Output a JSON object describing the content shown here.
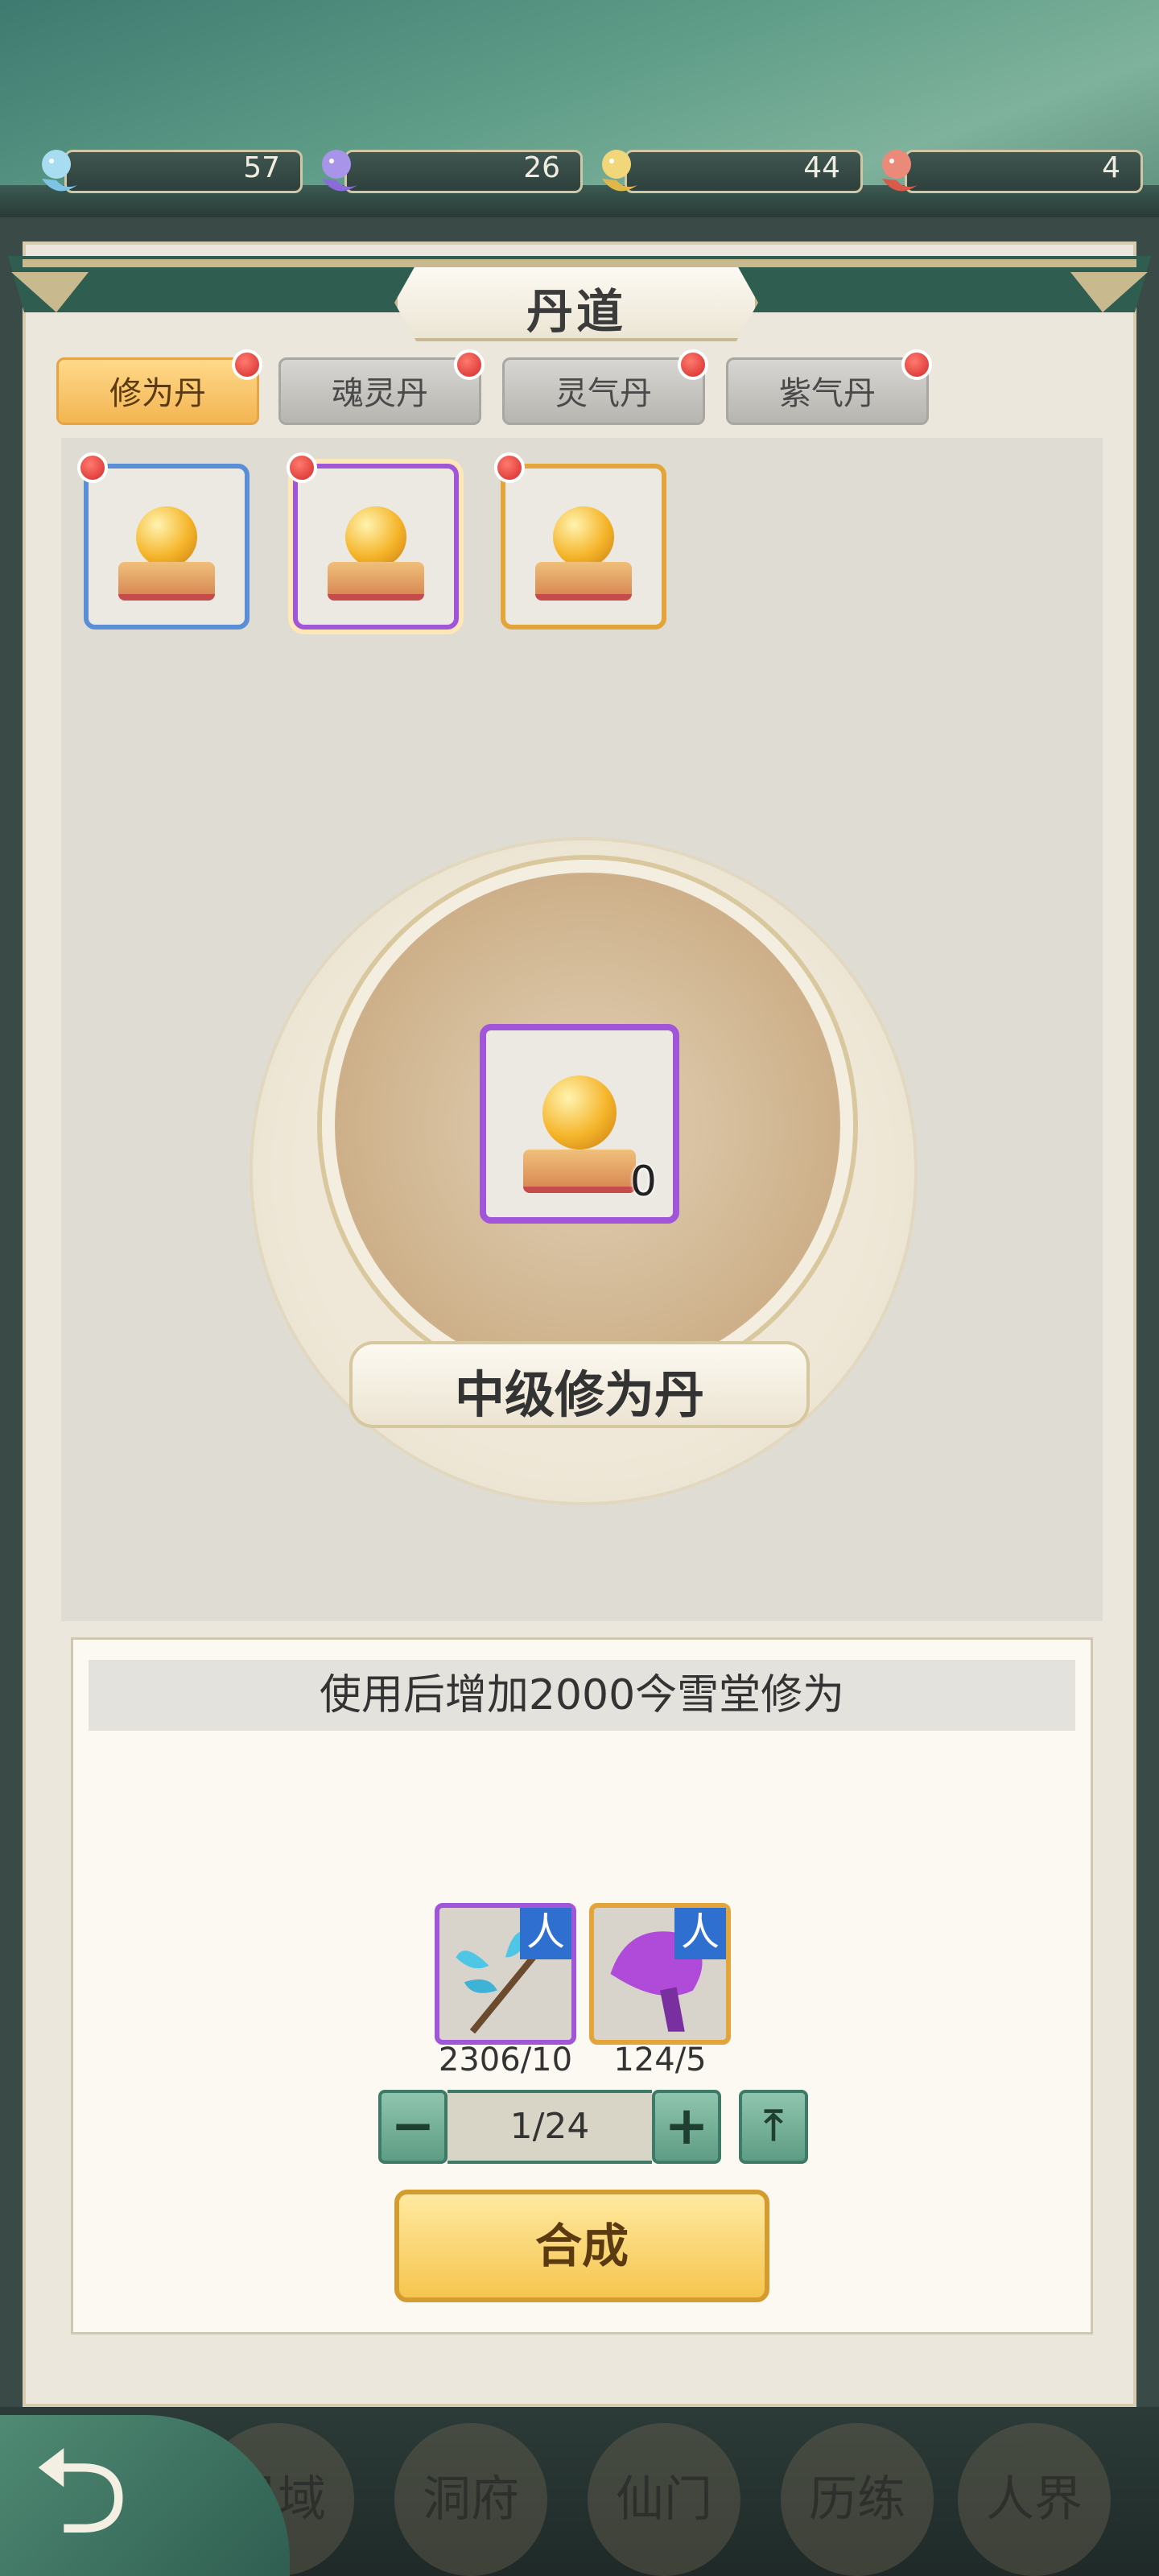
{
  "resources": [
    {
      "name": "blue-spirit",
      "value": "57",
      "color": "#7ec4e6"
    },
    {
      "name": "purple-spirit",
      "value": "26",
      "color": "#8a6cd8"
    },
    {
      "name": "gold-spirit",
      "value": "44",
      "color": "#e0b84a"
    },
    {
      "name": "red-spirit",
      "value": "4",
      "color": "#d85a4a"
    }
  ],
  "header": {
    "title": "丹道"
  },
  "tabs": [
    {
      "label": "修为丹",
      "active": true
    },
    {
      "label": "魂灵丹",
      "active": false
    },
    {
      "label": "灵气丹",
      "active": false
    },
    {
      "label": "紫气丹",
      "active": false
    }
  ],
  "items": [
    {
      "quality": "blue"
    },
    {
      "quality": "purple",
      "selected": true
    },
    {
      "quality": "gold"
    }
  ],
  "selected": {
    "count": "0",
    "name": "中级修为丹",
    "description": "使用后增加2000今雪堂修为"
  },
  "materials": [
    {
      "quality": "purple",
      "tag": "人",
      "count": "2306/10",
      "icon": "blue-herb-icon"
    },
    {
      "quality": "gold",
      "tag": "人",
      "count": "124/5",
      "icon": "purple-mushroom-icon"
    }
  ],
  "quantity": {
    "minus": "−",
    "value": "1/24",
    "plus": "+",
    "max": "⤒"
  },
  "actions": {
    "synthesize": "合成"
  },
  "bottom_nav": [
    "界域",
    "洞府",
    "仙门",
    "历练",
    "人界"
  ],
  "colors": {
    "accent": "#f3b552",
    "panel": "#ece7dc",
    "teal": "#5e9c84"
  }
}
